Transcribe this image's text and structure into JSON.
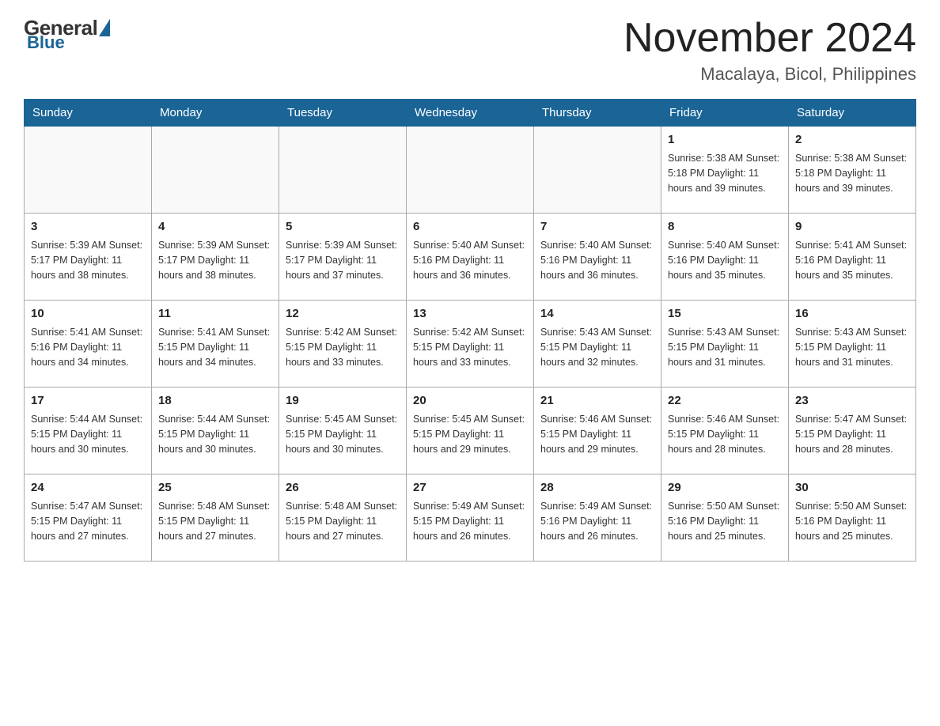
{
  "logo": {
    "general": "General",
    "blue": "Blue"
  },
  "title": {
    "month": "November 2024",
    "location": "Macalaya, Bicol, Philippines"
  },
  "weekdays": [
    "Sunday",
    "Monday",
    "Tuesday",
    "Wednesday",
    "Thursday",
    "Friday",
    "Saturday"
  ],
  "weeks": [
    [
      {
        "day": "",
        "info": ""
      },
      {
        "day": "",
        "info": ""
      },
      {
        "day": "",
        "info": ""
      },
      {
        "day": "",
        "info": ""
      },
      {
        "day": "",
        "info": ""
      },
      {
        "day": "1",
        "info": "Sunrise: 5:38 AM\nSunset: 5:18 PM\nDaylight: 11 hours and 39 minutes."
      },
      {
        "day": "2",
        "info": "Sunrise: 5:38 AM\nSunset: 5:18 PM\nDaylight: 11 hours and 39 minutes."
      }
    ],
    [
      {
        "day": "3",
        "info": "Sunrise: 5:39 AM\nSunset: 5:17 PM\nDaylight: 11 hours and 38 minutes."
      },
      {
        "day": "4",
        "info": "Sunrise: 5:39 AM\nSunset: 5:17 PM\nDaylight: 11 hours and 38 minutes."
      },
      {
        "day": "5",
        "info": "Sunrise: 5:39 AM\nSunset: 5:17 PM\nDaylight: 11 hours and 37 minutes."
      },
      {
        "day": "6",
        "info": "Sunrise: 5:40 AM\nSunset: 5:16 PM\nDaylight: 11 hours and 36 minutes."
      },
      {
        "day": "7",
        "info": "Sunrise: 5:40 AM\nSunset: 5:16 PM\nDaylight: 11 hours and 36 minutes."
      },
      {
        "day": "8",
        "info": "Sunrise: 5:40 AM\nSunset: 5:16 PM\nDaylight: 11 hours and 35 minutes."
      },
      {
        "day": "9",
        "info": "Sunrise: 5:41 AM\nSunset: 5:16 PM\nDaylight: 11 hours and 35 minutes."
      }
    ],
    [
      {
        "day": "10",
        "info": "Sunrise: 5:41 AM\nSunset: 5:16 PM\nDaylight: 11 hours and 34 minutes."
      },
      {
        "day": "11",
        "info": "Sunrise: 5:41 AM\nSunset: 5:15 PM\nDaylight: 11 hours and 34 minutes."
      },
      {
        "day": "12",
        "info": "Sunrise: 5:42 AM\nSunset: 5:15 PM\nDaylight: 11 hours and 33 minutes."
      },
      {
        "day": "13",
        "info": "Sunrise: 5:42 AM\nSunset: 5:15 PM\nDaylight: 11 hours and 33 minutes."
      },
      {
        "day": "14",
        "info": "Sunrise: 5:43 AM\nSunset: 5:15 PM\nDaylight: 11 hours and 32 minutes."
      },
      {
        "day": "15",
        "info": "Sunrise: 5:43 AM\nSunset: 5:15 PM\nDaylight: 11 hours and 31 minutes."
      },
      {
        "day": "16",
        "info": "Sunrise: 5:43 AM\nSunset: 5:15 PM\nDaylight: 11 hours and 31 minutes."
      }
    ],
    [
      {
        "day": "17",
        "info": "Sunrise: 5:44 AM\nSunset: 5:15 PM\nDaylight: 11 hours and 30 minutes."
      },
      {
        "day": "18",
        "info": "Sunrise: 5:44 AM\nSunset: 5:15 PM\nDaylight: 11 hours and 30 minutes."
      },
      {
        "day": "19",
        "info": "Sunrise: 5:45 AM\nSunset: 5:15 PM\nDaylight: 11 hours and 30 minutes."
      },
      {
        "day": "20",
        "info": "Sunrise: 5:45 AM\nSunset: 5:15 PM\nDaylight: 11 hours and 29 minutes."
      },
      {
        "day": "21",
        "info": "Sunrise: 5:46 AM\nSunset: 5:15 PM\nDaylight: 11 hours and 29 minutes."
      },
      {
        "day": "22",
        "info": "Sunrise: 5:46 AM\nSunset: 5:15 PM\nDaylight: 11 hours and 28 minutes."
      },
      {
        "day": "23",
        "info": "Sunrise: 5:47 AM\nSunset: 5:15 PM\nDaylight: 11 hours and 28 minutes."
      }
    ],
    [
      {
        "day": "24",
        "info": "Sunrise: 5:47 AM\nSunset: 5:15 PM\nDaylight: 11 hours and 27 minutes."
      },
      {
        "day": "25",
        "info": "Sunrise: 5:48 AM\nSunset: 5:15 PM\nDaylight: 11 hours and 27 minutes."
      },
      {
        "day": "26",
        "info": "Sunrise: 5:48 AM\nSunset: 5:15 PM\nDaylight: 11 hours and 27 minutes."
      },
      {
        "day": "27",
        "info": "Sunrise: 5:49 AM\nSunset: 5:15 PM\nDaylight: 11 hours and 26 minutes."
      },
      {
        "day": "28",
        "info": "Sunrise: 5:49 AM\nSunset: 5:16 PM\nDaylight: 11 hours and 26 minutes."
      },
      {
        "day": "29",
        "info": "Sunrise: 5:50 AM\nSunset: 5:16 PM\nDaylight: 11 hours and 25 minutes."
      },
      {
        "day": "30",
        "info": "Sunrise: 5:50 AM\nSunset: 5:16 PM\nDaylight: 11 hours and 25 minutes."
      }
    ]
  ]
}
